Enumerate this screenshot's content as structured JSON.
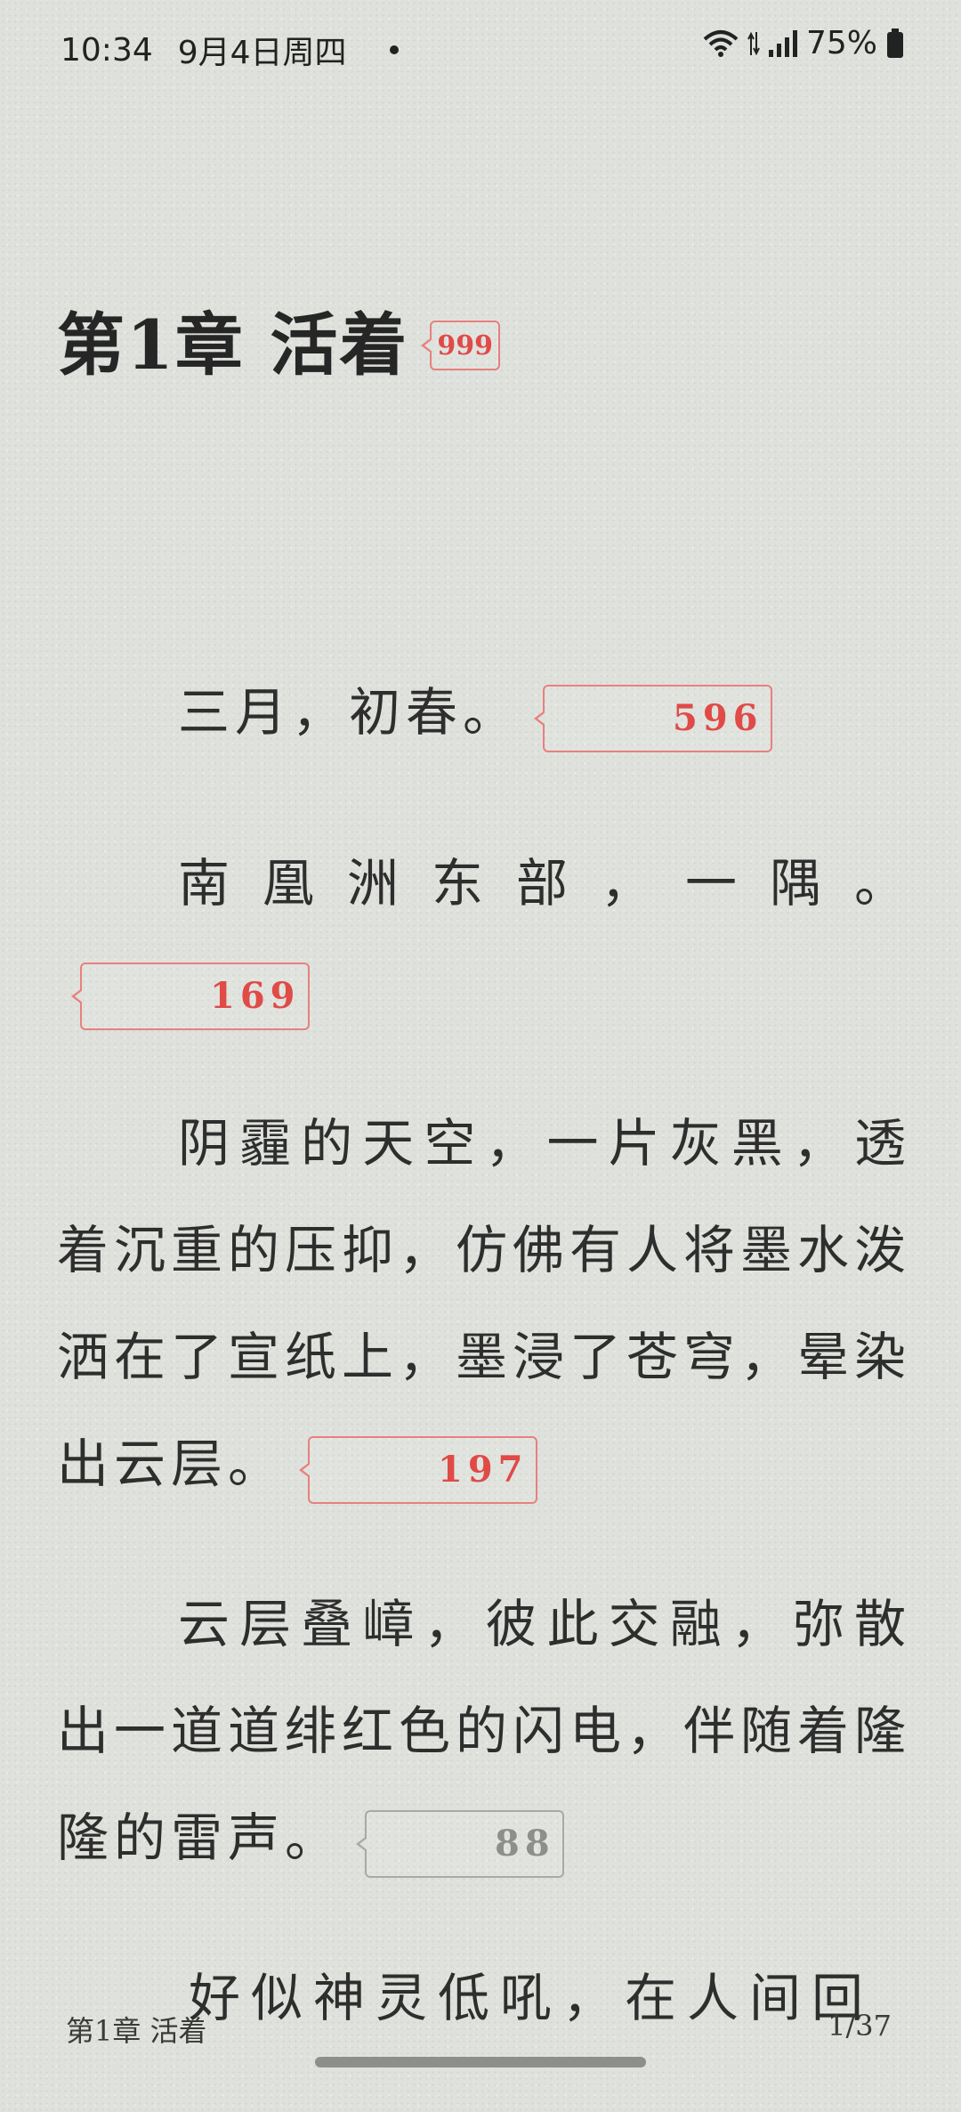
{
  "status_bar": {
    "time": "10:34",
    "date": "9月4日周四",
    "battery": "75%"
  },
  "chapter": {
    "title": "第1章 活着",
    "title_comments": "999"
  },
  "paragraphs": [
    {
      "text": "三月，初春。",
      "comments": "596"
    },
    {
      "text": "南凰洲东部，一隅。",
      "comments": "169"
    },
    {
      "text": "阴霾的天空，一片灰黑，透着沉重的压抑，仿佛有人将墨水泼洒在了宣纸上，墨浸了苍穹，晕染出云层。",
      "comments": "197"
    },
    {
      "text": "云层叠嶂，彼此交融，弥散出一道道绯红色的闪电，伴随着隆隆的雷声。",
      "comments": "88"
    },
    {
      "text": "好似神灵低吼，在人间回"
    }
  ],
  "footer": {
    "chapter": "第1章 活着",
    "page": "1/37"
  },
  "colors": {
    "background": "#dfe2dc",
    "badge_red": "#e04a47",
    "badge_gray": "#8d8f8b"
  }
}
